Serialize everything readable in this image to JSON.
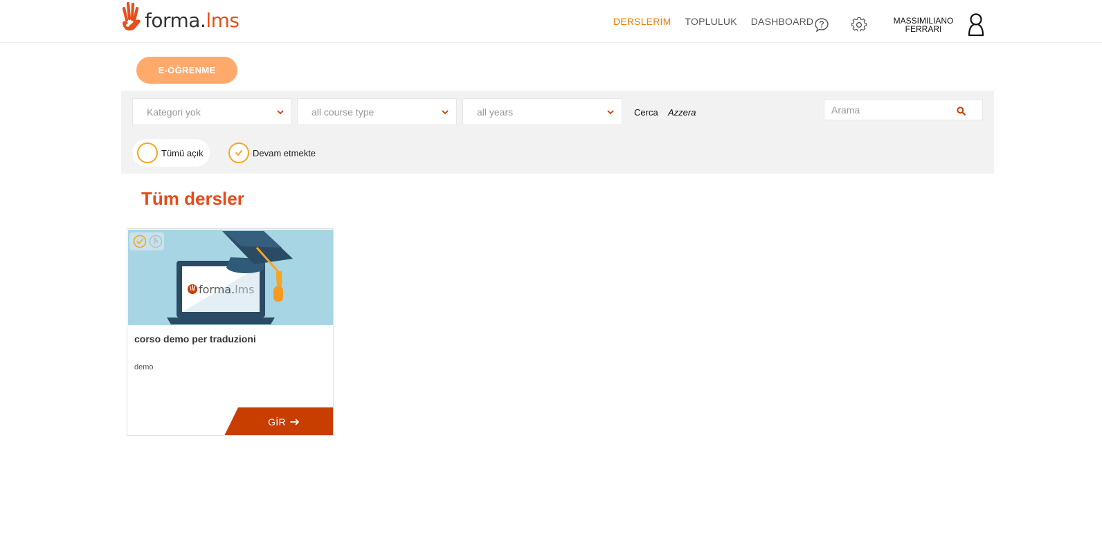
{
  "header": {
    "logo": {
      "text": "forma.",
      "accent": "lms"
    },
    "nav": [
      {
        "label": "DERSLERİM",
        "active": true
      },
      {
        "label": "TOPLULUK",
        "active": false
      },
      {
        "label": "DASHBOARD",
        "active": false
      }
    ],
    "user": {
      "first": "MASSIMILIANO",
      "last": "FERRARI"
    }
  },
  "tabs": {
    "elearning": "E-ÖĞRENME"
  },
  "filters": {
    "category": "Kategori yok",
    "course_type": "all course type",
    "years": "all years",
    "search_label": "Cerca",
    "reset_label": "Azzera",
    "search_placeholder": "Arama",
    "status_all": "Tümü açık",
    "status_in_progress": "Devam etmekte"
  },
  "main": {
    "title": "Tüm dersler",
    "courses": [
      {
        "title": "corso demo per traduzioni",
        "category": "demo",
        "enter_label": "GİR"
      }
    ]
  },
  "colors": {
    "accent": "#f07d00",
    "title_red": "#e64a19",
    "button_orange": "#ffa96b",
    "enter_button": "#c83d00",
    "panel_bg": "#f2f2f2"
  }
}
